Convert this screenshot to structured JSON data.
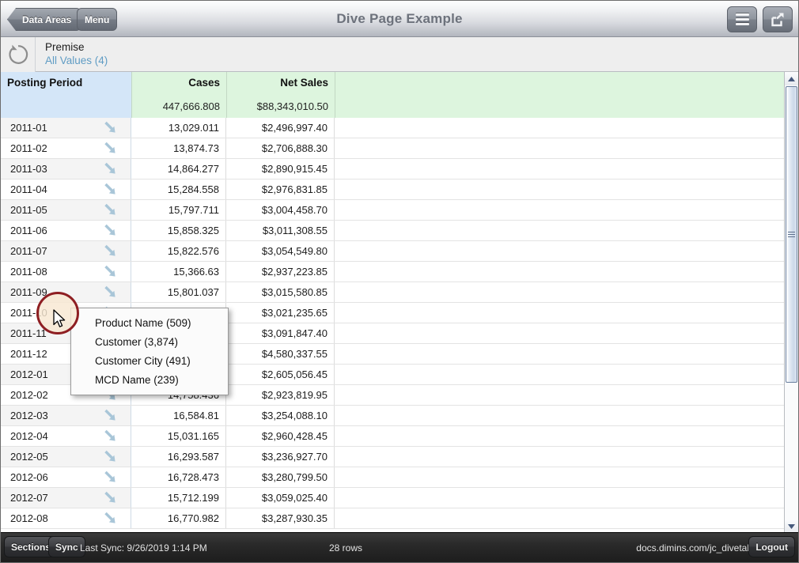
{
  "titlebar": {
    "back_label": "Data Areas",
    "menu_label": "Menu",
    "title": "Dive Page Example",
    "hamburger_icon": "hamburger-menu-icon",
    "share_icon": "share-export-icon"
  },
  "premise": {
    "refresh_icon": "refresh-circle-arrow-icon",
    "label": "Premise",
    "value": "All Values (4)"
  },
  "table": {
    "columns": [
      {
        "label": "Posting Period",
        "total": "",
        "kind": "dimension"
      },
      {
        "label": "Cases",
        "total": "447,666.808",
        "kind": "measure"
      },
      {
        "label": "Net Sales",
        "total": "$88,343,010.50",
        "kind": "measure"
      }
    ],
    "dive_icon": "dive-down-arrow-icon",
    "rows": [
      {
        "period": "2011-01",
        "cases": "13,029.011",
        "net_sales": "$2,496,997.40"
      },
      {
        "period": "2011-02",
        "cases": "13,874.73",
        "net_sales": "$2,706,888.30"
      },
      {
        "period": "2011-03",
        "cases": "14,864.277",
        "net_sales": "$2,890,915.45"
      },
      {
        "period": "2011-04",
        "cases": "15,284.558",
        "net_sales": "$2,976,831.85"
      },
      {
        "period": "2011-05",
        "cases": "15,797.711",
        "net_sales": "$3,004,458.70"
      },
      {
        "period": "2011-06",
        "cases": "15,858.325",
        "net_sales": "$3,011,308.55"
      },
      {
        "period": "2011-07",
        "cases": "15,822.576",
        "net_sales": "$3,054,549.80"
      },
      {
        "period": "2011-08",
        "cases": "15,366.63",
        "net_sales": "$2,937,223.85"
      },
      {
        "period": "2011-09",
        "cases": "15,801.037",
        "net_sales": "$3,015,580.85"
      },
      {
        "period": "2011-10",
        "cases": "",
        "net_sales": "$3,021,235.65"
      },
      {
        "period": "2011-11",
        "cases": "",
        "net_sales": "$3,091,847.40"
      },
      {
        "period": "2011-12",
        "cases": "",
        "net_sales": "$4,580,337.55"
      },
      {
        "period": "2012-01",
        "cases": "",
        "net_sales": "$2,605,056.45"
      },
      {
        "period": "2012-02",
        "cases": "14,758.436",
        "net_sales": "$2,923,819.95"
      },
      {
        "period": "2012-03",
        "cases": "16,584.81",
        "net_sales": "$3,254,088.10"
      },
      {
        "period": "2012-04",
        "cases": "15,031.165",
        "net_sales": "$2,960,428.45"
      },
      {
        "period": "2012-05",
        "cases": "16,293.587",
        "net_sales": "$3,236,927.70"
      },
      {
        "period": "2012-06",
        "cases": "16,728.473",
        "net_sales": "$3,280,799.50"
      },
      {
        "period": "2012-07",
        "cases": "15,712.199",
        "net_sales": "$3,059,025.40"
      },
      {
        "period": "2012-08",
        "cases": "16,770.982",
        "net_sales": "$3,287,930.35"
      }
    ]
  },
  "context_menu": {
    "items": [
      {
        "label": "Product Name (509)"
      },
      {
        "label": "Customer (3,874)"
      },
      {
        "label": "Customer City (491)"
      },
      {
        "label": "MCD Name (239)"
      }
    ]
  },
  "scrollbar": {
    "up_icon": "scroll-up-arrow-icon",
    "down_icon": "scroll-down-arrow-icon",
    "thumb_grip_icon": "scrollbar-grip-icon"
  },
  "statusbar": {
    "sections_label": "Sections",
    "sync_label": "Sync",
    "last_sync": "Last Sync: 9/26/2019 1:14 PM",
    "row_count": "28 rows",
    "url": "docs.dimins.com/jc_divetab",
    "logout_label": "Logout"
  },
  "colors": {
    "dimension_header": "#d4e6f8",
    "measure_header": "#ddf5de",
    "link_text": "#5f9cc4",
    "highlight_ring": "#8e1e22",
    "dive_arrow": "#a9c6d8"
  }
}
